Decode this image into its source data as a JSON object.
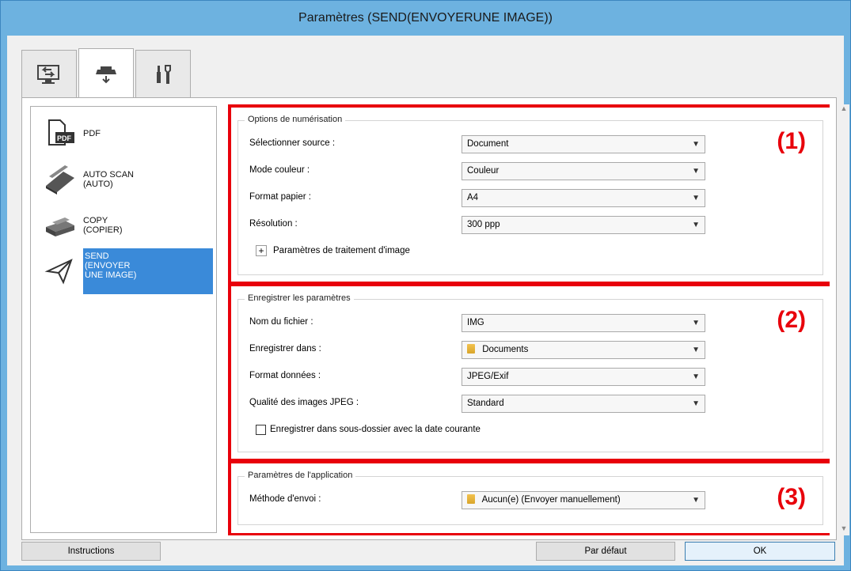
{
  "window": {
    "title": "Paramètres (SEND(ENVOYERUNE IMAGE))"
  },
  "tabs": [
    {
      "name": "scan-from-computer",
      "icon": "monitor-arrow-icon"
    },
    {
      "name": "scan-from-operation-panel",
      "icon": "scanner-down-icon",
      "active": true
    },
    {
      "name": "general-settings",
      "icon": "tools-icon"
    }
  ],
  "left_list": {
    "items": [
      {
        "label": "PDF",
        "icon": "pdf-document-icon"
      },
      {
        "label": "AUTO SCAN\n(AUTO)",
        "icon": "scanner-icon"
      },
      {
        "label": "COPY\n(COPIER)",
        "icon": "printer-icon"
      },
      {
        "label": "SEND\n(ENVOYER\nUNE IMAGE)",
        "icon": "paper-plane-icon",
        "selected": true
      }
    ]
  },
  "scan_options": {
    "title": "Options de numérisation",
    "marker": "(1)",
    "source_label": "Sélectionner source :",
    "source_value": "Document",
    "color_label": "Mode couleur :",
    "color_value": "Couleur",
    "paper_label": "Format papier :",
    "paper_value": "A4",
    "resolution_label": "Résolution :",
    "resolution_value": "300 ppp",
    "expander_label": "Paramètres de traitement d'image",
    "expander_symbol": "+"
  },
  "save_settings": {
    "title": "Enregistrer les paramètres",
    "marker": "(2)",
    "filename_label": "Nom du fichier :",
    "filename_value": "IMG",
    "savein_label": "Enregistrer dans :",
    "savein_value": "Documents",
    "format_label": "Format données :",
    "format_value": "JPEG/Exif",
    "quality_label": "Qualité des images JPEG :",
    "quality_value": "Standard",
    "subfolder_label": "Enregistrer dans sous-dossier avec la date courante",
    "subfolder_checked": false
  },
  "app_settings": {
    "title": "Paramètres de l'application",
    "marker": "(3)",
    "method_label": "Méthode d'envoi :",
    "method_value": "Aucun(e) (Envoyer manuellement)"
  },
  "buttons": {
    "instructions": "Instructions",
    "default": "Par défaut",
    "ok": "OK"
  },
  "colors": {
    "title_bar": "#6db2e0",
    "highlight_box": "#e8000b",
    "selection": "#3a8ad9"
  }
}
